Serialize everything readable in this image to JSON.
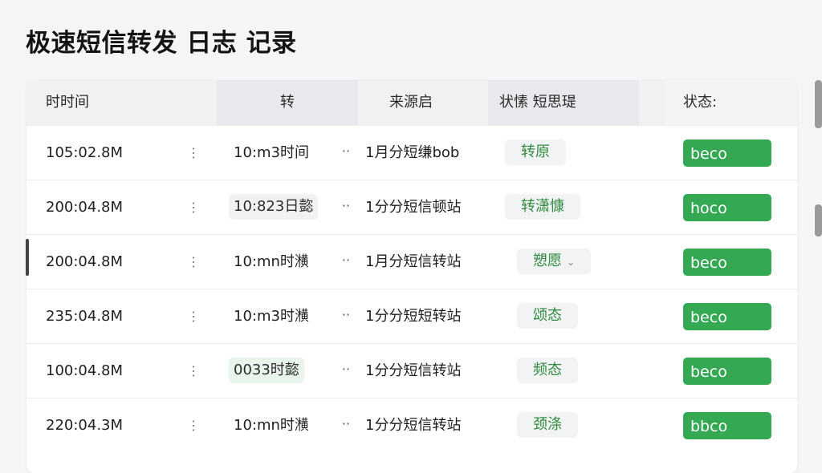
{
  "page_title": "极速短信转发 日志 记录",
  "columns": [
    "时时间",
    "转",
    "来源启",
    "状愫 短思瑅",
    "状态:"
  ],
  "row_menu_glyph": "⋮",
  "row_more_glyph": "··",
  "rows": [
    {
      "time": "105:02.8M",
      "forward": "10:m3时间",
      "forward_style": "plain",
      "source": "1月分短缣bob",
      "tag": "转原",
      "tag_has_dropdown": false,
      "status": "beco"
    },
    {
      "time": "200:04.8M",
      "forward": "10:823日㦤",
      "forward_style": "gray",
      "source": "1分分短信顿站",
      "tag": "转潇慷",
      "tag_has_dropdown": false,
      "status": "hoco"
    },
    {
      "time": "200:04.8M",
      "forward": "10:mn时㶇",
      "forward_style": "plain",
      "source": "1月分短信转站",
      "tag": "愬愿",
      "tag_has_dropdown": true,
      "status": "beco"
    },
    {
      "time": "235:04.8M",
      "forward": "10:m3时㶇",
      "forward_style": "plain",
      "source": "1分分短短转站",
      "tag": "颂态",
      "tag_has_dropdown": false,
      "status": "beco"
    },
    {
      "time": "100:04.8M",
      "forward": "0033时㦤",
      "forward_style": "green",
      "source": "1分分短信转站",
      "tag": "频态",
      "tag_has_dropdown": false,
      "status": "beco"
    },
    {
      "time": "220:04.3M",
      "forward": "10:mn时㶇",
      "forward_style": "plain",
      "source": "1分分短信转站",
      "tag": "颈涤",
      "tag_has_dropdown": false,
      "status": "bbco"
    }
  ],
  "colors": {
    "status_button": "#34a853",
    "tag_text": "#2f8a3e",
    "header_bg": "#f0f1f3",
    "page_bg": "#f4f5f7"
  },
  "icons": {
    "row_menu": "vertical-dots-icon",
    "row_more": "horizontal-dots-icon",
    "dropdown": "chevron-down-icon"
  }
}
